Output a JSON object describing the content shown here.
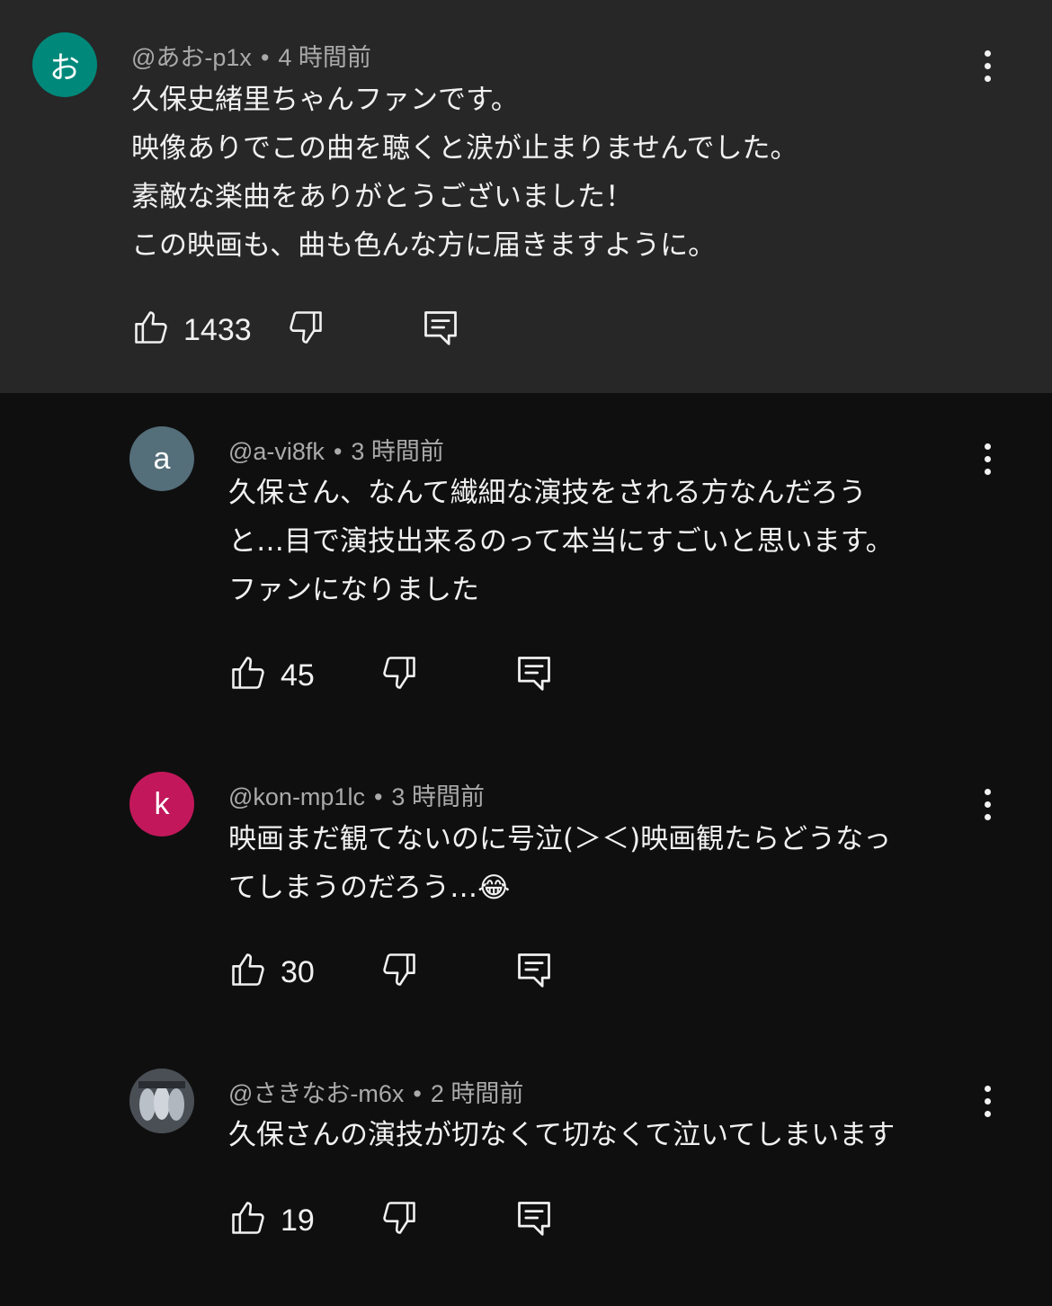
{
  "comments": [
    {
      "avatar_letter": "お",
      "avatar_color": "#00897b",
      "handle": "@あお-p1x",
      "time": "4 時間前",
      "text": "久保史緒里ちゃんファンです。\n映像ありでこの曲を聴くと涙が止まりませんでした。\n素敵な楽曲をありがとうございました！\nこの映画も、曲も色んな方に届きますように。",
      "likes": "1433"
    },
    {
      "avatar_letter": "a",
      "avatar_color": "#546e7a",
      "handle": "@a-vi8fk",
      "time": "3 時間前",
      "text": "久保さん、なんて繊細な演技をされる方なんだろう\nと…目で演技出来るのって本当にすごいと思います。\nファンになりました",
      "likes": "45"
    },
    {
      "avatar_letter": "k",
      "avatar_color": "#c2185b",
      "handle": "@kon-mp1lc",
      "time": "3 時間前",
      "text": "映画まだ観てないのに号泣(＞＜)映画観たらどうなっ\nてしまうのだろう…😂",
      "likes": "30"
    },
    {
      "avatar_letter": "",
      "avatar_color": "#6b7075",
      "handle": "@さきなお-m6x",
      "time": "2 時間前",
      "text": "久保さんの演技が切なくて切なくて泣いてしまいます",
      "likes": "19"
    }
  ],
  "separator": "•",
  "icons": {
    "like": "thumbs-up-icon",
    "dislike": "thumbs-down-icon",
    "reply": "reply-icon",
    "menu": "more-vert-icon"
  }
}
